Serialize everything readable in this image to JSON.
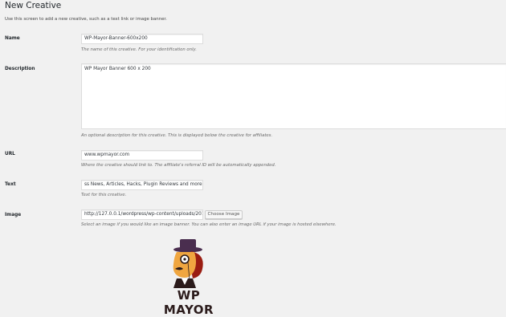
{
  "page": {
    "title": "New Creative",
    "intro": "Use this screen to add a new creative, such as a text link or image banner."
  },
  "fields": {
    "name": {
      "label": "Name",
      "value": "WP-Mayor-Banner-600x200",
      "hint": "The name of this creative. For your identification only."
    },
    "description": {
      "label": "Description",
      "value": "WP Mayor Banner 600 x 200",
      "hint": "An optional description for this creative. This is displayed below the creative for affiliates."
    },
    "url": {
      "label": "URL",
      "value": "www.wpmayor.com",
      "hint": "Where the creative should link to. The affiliate's referral ID will be automatically appended."
    },
    "text": {
      "label": "Text",
      "value": "ss News, Articles, Hacks, Plugin Reviews and more...",
      "hint": "Text for this creative."
    },
    "image": {
      "label": "Image",
      "value": "http://127.0.0.1/wordpress/wp-content/uploads/201",
      "button_label": "Choose Image",
      "hint": "Select an image if you would like an image banner. You can also enter an image URL if your image is hosted elsewhere."
    }
  },
  "preview": {
    "logo_text": "WP MAYOR",
    "icon": "wp-mayor-mascot-icon"
  },
  "colors": {
    "background": "#f1f1f1",
    "hat": "#4a2e4f",
    "face": "#f0a640",
    "hair": "#9a1d12",
    "logo_text": "#2b1b1b"
  }
}
